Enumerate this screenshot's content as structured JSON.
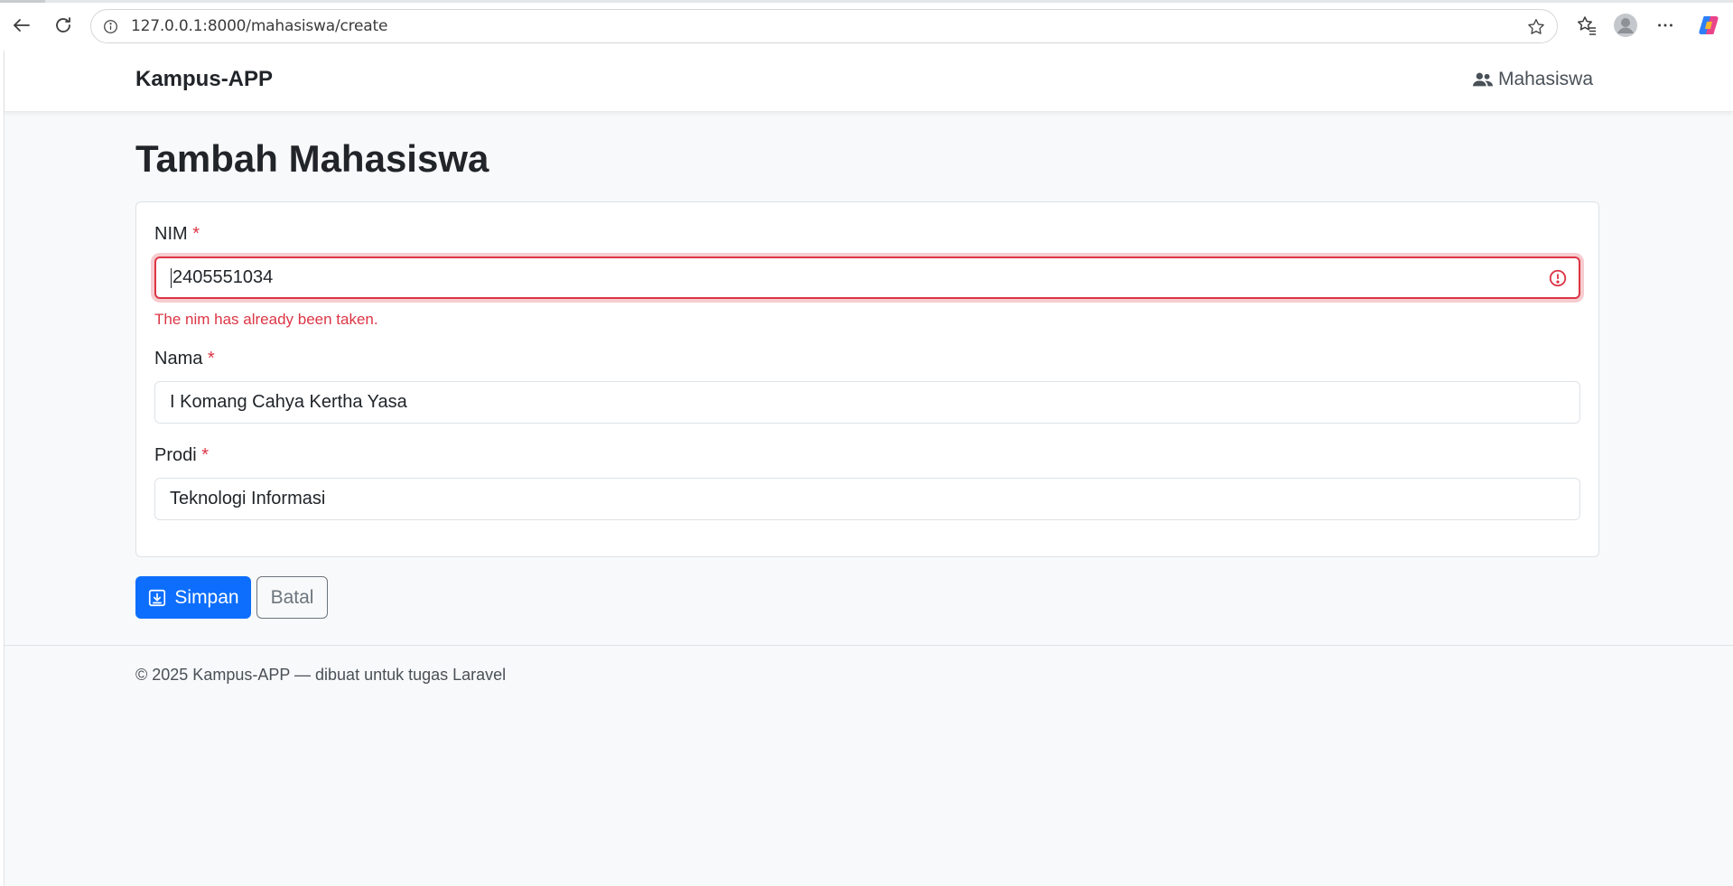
{
  "browser": {
    "url": "127.0.0.1:8000/mahasiswa/create"
  },
  "navbar": {
    "brand": "Kampus-APP",
    "link_mahasiswa": "Mahasiswa"
  },
  "page": {
    "title": "Tambah Mahasiswa"
  },
  "form": {
    "nim": {
      "label": "NIM",
      "required_mark": "*",
      "value": "2405551034",
      "error": "The nim has already been taken."
    },
    "nama": {
      "label": "Nama",
      "required_mark": "*",
      "value": "I Komang Cahya Kertha Yasa"
    },
    "prodi": {
      "label": "Prodi",
      "required_mark": "*",
      "value": "Teknologi Informasi"
    },
    "save_label": "Simpan",
    "cancel_label": "Batal"
  },
  "footer": {
    "text": "© 2025 Kampus-APP — dibuat untuk tugas Laravel"
  },
  "colors": {
    "primary": "#0d6efd",
    "danger": "#dc3545",
    "secondary": "#6c757d",
    "background": "#f8f9fa"
  }
}
